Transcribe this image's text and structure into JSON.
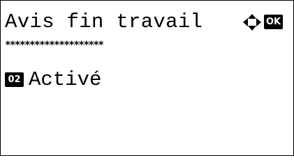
{
  "screen": {
    "title": "Avis fin travail",
    "ok_label": "OK",
    "separator": "********************",
    "nav_icon": "four-way-arrow-icon"
  },
  "option": {
    "number": "02",
    "label": "Activé"
  },
  "colors": {
    "foreground": "#000000",
    "background": "#ffffff"
  }
}
